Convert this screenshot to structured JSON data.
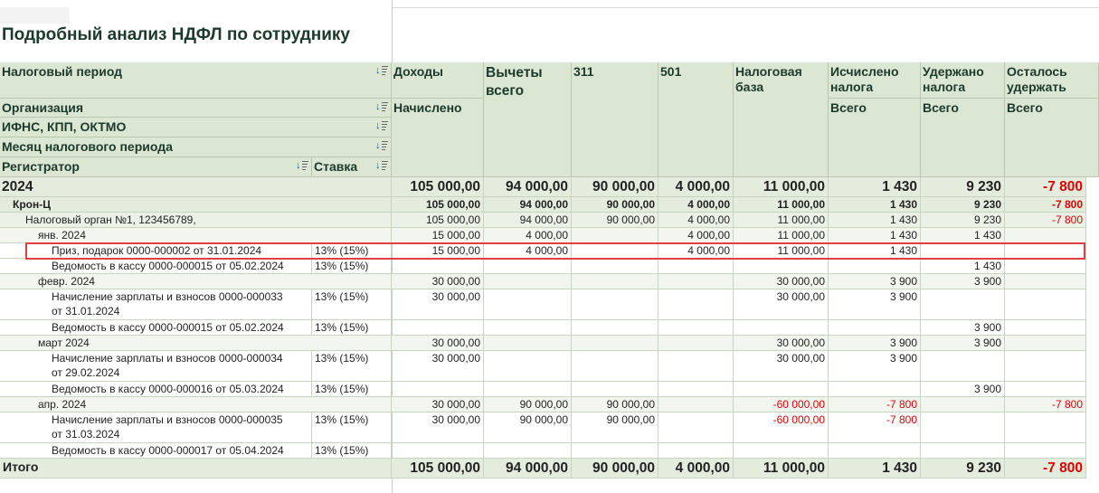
{
  "report": {
    "title": "Подробный анализ НДФЛ по сотруднику"
  },
  "header": {
    "tax_period": "Налоговый период",
    "organization": "Организация",
    "ifns": "ИФНС, КПП, ОКТМО",
    "month": "Месяц налогового периода",
    "registrar": "Регистратор",
    "rate": "Ставка",
    "income": "Доходы",
    "income_sub": "Начислено",
    "deductions": "Вычеты всего",
    "c311": "311",
    "c501": "501",
    "tax_base": "Налоговая база",
    "calc_tax": "Исчислено налога",
    "calc_tax_sub": "Всего",
    "withheld": "Удержано налога",
    "withheld_sub": "Всего",
    "remain": "Осталось удержать",
    "remain_sub": "Всего"
  },
  "rows": [
    {
      "label": "2024",
      "rate": "",
      "income": "105 000,00",
      "deductions": "94 000,00",
      "c311": "90 000,00",
      "c501": "4 000,00",
      "base": "11 000,00",
      "calc": "1 430",
      "withheld": "9 230",
      "remain": "-7 800"
    },
    {
      "label": "Крон-Ц",
      "rate": "",
      "income": "105 000,00",
      "deductions": "94 000,00",
      "c311": "90 000,00",
      "c501": "4 000,00",
      "base": "11 000,00",
      "calc": "1 430",
      "withheld": "9 230",
      "remain": "-7 800"
    },
    {
      "label": "Налоговый орган №1, 123456789,",
      "rate": "",
      "income": "105 000,00",
      "deductions": "94 000,00",
      "c311": "90 000,00",
      "c501": "4 000,00",
      "base": "11 000,00",
      "calc": "1 430",
      "withheld": "9 230",
      "remain": "-7 800"
    },
    {
      "label": "янв. 2024",
      "rate": "",
      "income": "15 000,00",
      "deductions": "4 000,00",
      "c311": "",
      "c501": "4 000,00",
      "base": "11 000,00",
      "calc": "1 430",
      "withheld": "1 430",
      "remain": ""
    },
    {
      "label": "Приз, подарок 0000-000002 от 31.01.2024",
      "rate": "13% (15%)",
      "income": "15 000,00",
      "deductions": "4 000,00",
      "c311": "",
      "c501": "4 000,00",
      "base": "11 000,00",
      "calc": "1 430",
      "withheld": "",
      "remain": ""
    },
    {
      "label": "Ведомость в кассу 0000-000015 от 05.02.2024",
      "rate": "13% (15%)",
      "income": "",
      "deductions": "",
      "c311": "",
      "c501": "",
      "base": "",
      "calc": "",
      "withheld": "1 430",
      "remain": ""
    },
    {
      "label": "февр. 2024",
      "rate": "",
      "income": "30 000,00",
      "deductions": "",
      "c311": "",
      "c501": "",
      "base": "30 000,00",
      "calc": "3 900",
      "withheld": "3 900",
      "remain": ""
    },
    {
      "label": "Начисление зарплаты и взносов 0000-000033",
      "label2": "от 31.01.2024",
      "rate": "13% (15%)",
      "income": "30 000,00",
      "deductions": "",
      "c311": "",
      "c501": "",
      "base": "30 000,00",
      "calc": "3 900",
      "withheld": "",
      "remain": ""
    },
    {
      "label": "Ведомость в кассу 0000-000015 от 05.02.2024",
      "rate": "13% (15%)",
      "income": "",
      "deductions": "",
      "c311": "",
      "c501": "",
      "base": "",
      "calc": "",
      "withheld": "3 900",
      "remain": ""
    },
    {
      "label": "март 2024",
      "rate": "",
      "income": "30 000,00",
      "deductions": "",
      "c311": "",
      "c501": "",
      "base": "30 000,00",
      "calc": "3 900",
      "withheld": "3 900",
      "remain": ""
    },
    {
      "label": "Начисление зарплаты и взносов 0000-000034",
      "label2": "от 29.02.2024",
      "rate": "13% (15%)",
      "income": "30 000,00",
      "deductions": "",
      "c311": "",
      "c501": "",
      "base": "30 000,00",
      "calc": "3 900",
      "withheld": "",
      "remain": ""
    },
    {
      "label": "Ведомость в кассу 0000-000016 от 05.03.2024",
      "rate": "13% (15%)",
      "income": "",
      "deductions": "",
      "c311": "",
      "c501": "",
      "base": "",
      "calc": "",
      "withheld": "3 900",
      "remain": ""
    },
    {
      "label": "апр. 2024",
      "rate": "",
      "income": "30 000,00",
      "deductions": "90 000,00",
      "c311": "90 000,00",
      "c501": "",
      "base": "-60 000,00",
      "calc": "-7 800",
      "withheld": "",
      "remain": "-7 800"
    },
    {
      "label": "Начисление зарплаты и взносов 0000-000035",
      "label2": "от 31.03.2024",
      "rate": "13% (15%)",
      "income": "30 000,00",
      "deductions": "90 000,00",
      "c311": "90 000,00",
      "c501": "",
      "base": "-60 000,00",
      "calc": "-7 800",
      "withheld": "",
      "remain": ""
    },
    {
      "label": "Ведомость в кассу 0000-000017 от 05.04.2024",
      "rate": "13% (15%)",
      "income": "",
      "deductions": "",
      "c311": "",
      "c501": "",
      "base": "",
      "calc": "",
      "withheld": "",
      "remain": ""
    }
  ],
  "total": {
    "label": "Итого",
    "income": "105 000,00",
    "deductions": "94 000,00",
    "c311": "90 000,00",
    "c501": "4 000,00",
    "base": "11 000,00",
    "calc": "1 430",
    "withheld": "9 230",
    "remain": "-7 800"
  }
}
